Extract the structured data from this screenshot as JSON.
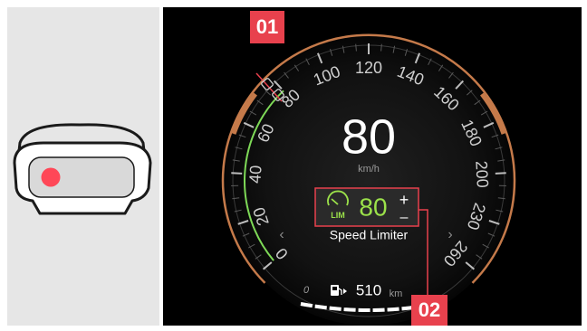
{
  "callouts": {
    "c1": "01",
    "c2": "02"
  },
  "speed": {
    "value": "80",
    "unit": "km/h"
  },
  "gauge_ticks": [
    "0",
    "20",
    "40",
    "60",
    "80",
    "100",
    "120",
    "140",
    "160",
    "180",
    "200",
    "230",
    "260"
  ],
  "limiter": {
    "icon_text": "LIM",
    "value": "80",
    "plus": "+",
    "minus": "–",
    "label": "Speed Limiter"
  },
  "nav": {
    "left": "‹",
    "right": "›"
  },
  "fuel": {
    "value": "510",
    "unit": "km",
    "zero": "0"
  },
  "colors": {
    "callout": "#e8414d",
    "limiter_green": "#9be14a",
    "arc_copper": "#c57a4a",
    "indicator_red": "#ff4757"
  }
}
